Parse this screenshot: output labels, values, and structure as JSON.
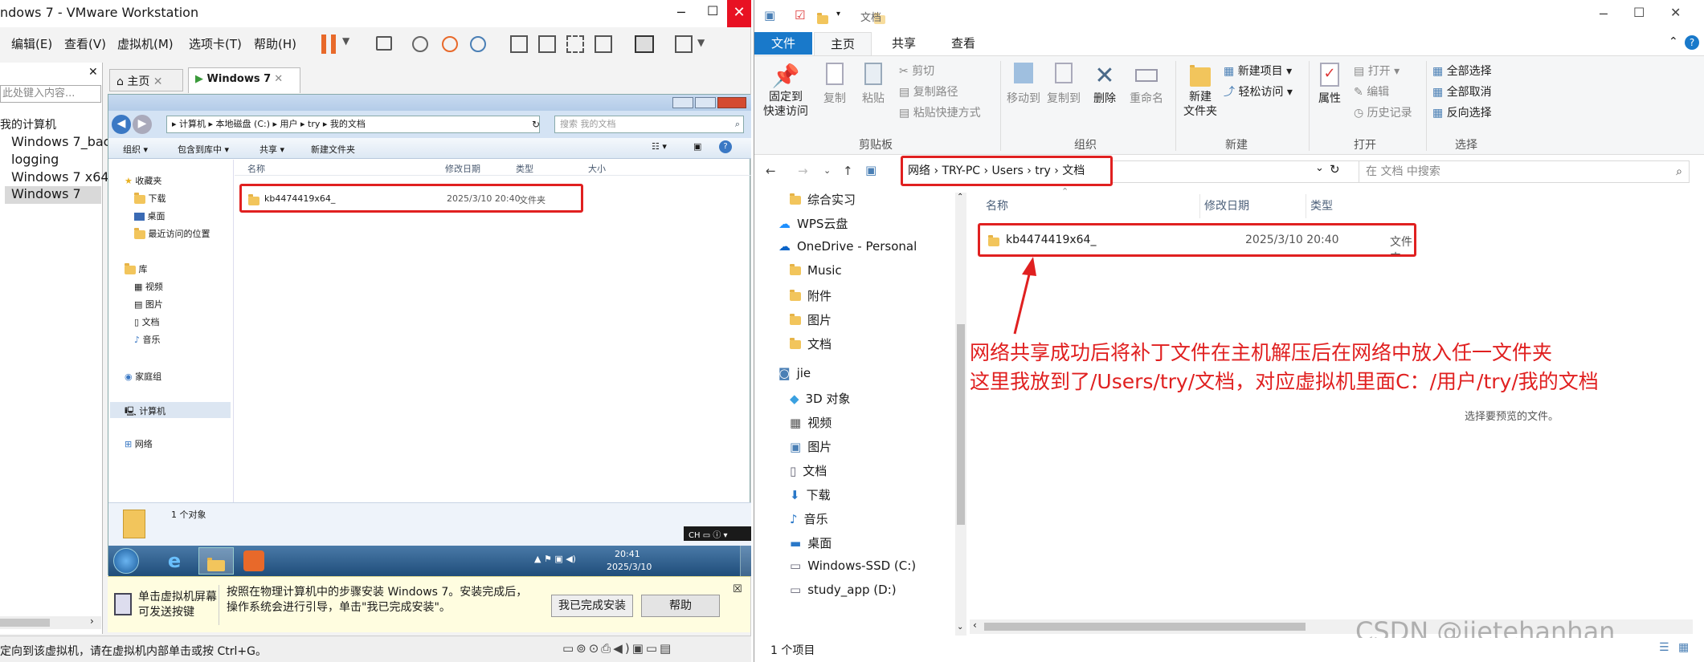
{
  "vm": {
    "title": "ndows 7 - VMware Workstation",
    "menu": [
      "编辑(E)",
      "查看(V)",
      "虚拟机(M)",
      "选项卡(T)",
      "帮助(H)"
    ],
    "library_search_placeholder": "此处键入内容...",
    "library_items": [
      "我的计算机",
      "Windows 7_bac",
      "logging",
      "Windows 7 x64",
      "Windows 7"
    ],
    "tabs": [
      "主页",
      "Windows 7"
    ],
    "bottom_status": "定向到该虚拟机，请在虚拟机内部单击或按 Ctrl+G。",
    "hint_left": "单击虚拟机屏幕\n可发送按键",
    "hint_main": "按照在物理计算机中的步骤安装 Windows 7。安装完成后，\n操作系统会进行引导，单击\"我已完成安装\"。",
    "btn_done": "我已完成安装",
    "btn_help": "帮助"
  },
  "win7": {
    "breadcrumb": [
      "计算机",
      "本地磁盘 (C:)",
      "用户",
      "try",
      "我的文档"
    ],
    "search_placeholder": "搜索 我的文档",
    "toolbar": [
      "组织 ▾",
      "包含到库中 ▾",
      "共享 ▾",
      "新建文件夹"
    ],
    "nav": {
      "favorites": "收藏夹",
      "fav_items": [
        "下载",
        "桌面",
        "最近访问的位置"
      ],
      "library": "库",
      "lib_items": [
        "视频",
        "图片",
        "文档",
        "音乐"
      ],
      "homegroup": "家庭组",
      "computer": "计算机",
      "network": "网络"
    },
    "columns": [
      "名称",
      "修改日期",
      "类型",
      "大小"
    ],
    "file": {
      "name": "kb4474419x64_",
      "date": "2025/3/10 20:40",
      "type": "文件夹"
    },
    "count": "1 个对象",
    "tray_time": "20:41",
    "tray_date": "2025/3/10",
    "lang": "CH"
  },
  "explorer": {
    "title": "文档",
    "ribbon_tabs": [
      "文件",
      "主页",
      "共享",
      "查看"
    ],
    "groups": {
      "clipboard": "剪贴板",
      "organize": "组织",
      "new": "新建",
      "open": "打开",
      "select": "选择"
    },
    "btns": {
      "pin": "固定到\n快速访问",
      "copy": "复制",
      "paste": "粘贴",
      "cut": "剪切",
      "copy_path": "复制路径",
      "paste_shortcut": "粘贴快捷方式",
      "move_to": "移动到",
      "copy_to": "复制到",
      "delete": "删除",
      "rename": "重命名",
      "new_folder": "新建\n文件夹",
      "new_item": "新建项目 ▾",
      "easy_access": "轻松访问 ▾",
      "properties": "属性",
      "open": "打开 ▾",
      "edit": "编辑",
      "history": "历史记录",
      "select_all": "全部选择",
      "select_none": "全部取消",
      "invert": "反向选择"
    },
    "address": [
      "网络",
      "TRY-PC",
      "Users",
      "try",
      "文档"
    ],
    "search_placeholder": "在 文档 中搜索",
    "nav_items": [
      "综合实习",
      "WPS云盘",
      "OneDrive - Personal",
      "Music",
      "附件",
      "图片",
      "文档",
      "jie",
      "3D 对象",
      "视频",
      "图片",
      "文档",
      "下载",
      "音乐",
      "桌面",
      "Windows-SSD (C:)",
      "study_app (D:)"
    ],
    "columns": [
      "名称",
      "修改日期",
      "类型"
    ],
    "file": {
      "name": "kb4474419x64_",
      "date": "2025/3/10 20:40",
      "type": "文件夹"
    },
    "preview_hint": "选择要预览的文件。",
    "status": "1 个项目"
  },
  "annotation": {
    "line1": "网络共享成功后将补丁文件在主机解压后在网络中放入任一文件夹",
    "line2": "这里我放到了/Users/try/文档，对应虚拟机里面C：/用户/try/我的文档"
  },
  "watermark": "CSDN @jietehanhan",
  "colors": {
    "red": "#e02020",
    "ribbon_blue": "#1979ca",
    "win7_taskbar": "#1f4d7a"
  }
}
